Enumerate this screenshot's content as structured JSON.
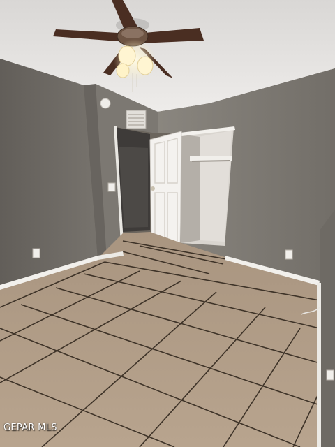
{
  "watermark": {
    "text": "GEPAR MLS"
  },
  "colors": {
    "ceiling": "#e4e2e0",
    "wall_left": "#6e6a65",
    "wall_back": "#7a7670",
    "wall_right": "#837f79",
    "tile": "#b3a08a",
    "grout": "#3e3328",
    "baseboard": "#f2f0ec",
    "door": "#f4f2ef",
    "fan_blade": "#4a2e22",
    "fan_light": "#fff2c4"
  },
  "icons": [
    "ceiling-fan-icon",
    "smoke-detector-icon",
    "air-vent-icon",
    "electrical-outlet-icon",
    "light-switch-icon"
  ]
}
